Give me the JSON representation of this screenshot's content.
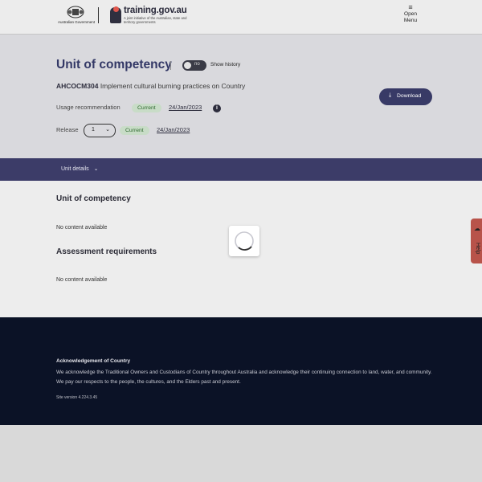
{
  "header": {
    "gov_logo_text": "Australian Government",
    "site_name": "training.gov.au",
    "site_tagline": "A joint initiative of the Australian, state and territory governments",
    "menu_label_1": "Open",
    "menu_label_2": "Menu"
  },
  "hero": {
    "title": "Unit of competency",
    "toggle_state": "no",
    "toggle_label": "Show history",
    "unit_code": "AHCOCM304",
    "unit_name": "Implement cultural burning practices on Country",
    "usage_label": "Usage recommendation",
    "usage_badge": "Current",
    "usage_date": "24/Jan/2023",
    "release_label": "Release",
    "release_value": "1",
    "release_badge": "Current",
    "release_date": "24/Jan/2023",
    "download_label": "Download"
  },
  "tabbar": {
    "tab_label": "Unit details"
  },
  "content": {
    "section1_title": "Unit of competency",
    "section1_empty": "No content available",
    "section2_title": "Assessment requirements",
    "section2_empty": "No content available"
  },
  "help": {
    "label": "Help"
  },
  "footer": {
    "ack_title": "Acknowledgement of Country",
    "ack_text": "We acknowledge the Traditional Owners and Custodians of Country throughout Australia and acknowledge their continuing connection to land, water, and community. We pay our respects to the people, the cultures, and the Elders past and present.",
    "site_version": "Site version 4.224.3.45"
  },
  "colors": {
    "primary": "#383a66",
    "tabbar": "#3c3c68",
    "footer": "#0b1226",
    "badge_bg": "#c8dcc7",
    "help_tab": "#b8534a"
  },
  "icons": [
    "crest-icon",
    "hamburger-icon",
    "info-icon",
    "chevron-down-icon",
    "download-icon",
    "spinner-icon",
    "chat-icon"
  ]
}
